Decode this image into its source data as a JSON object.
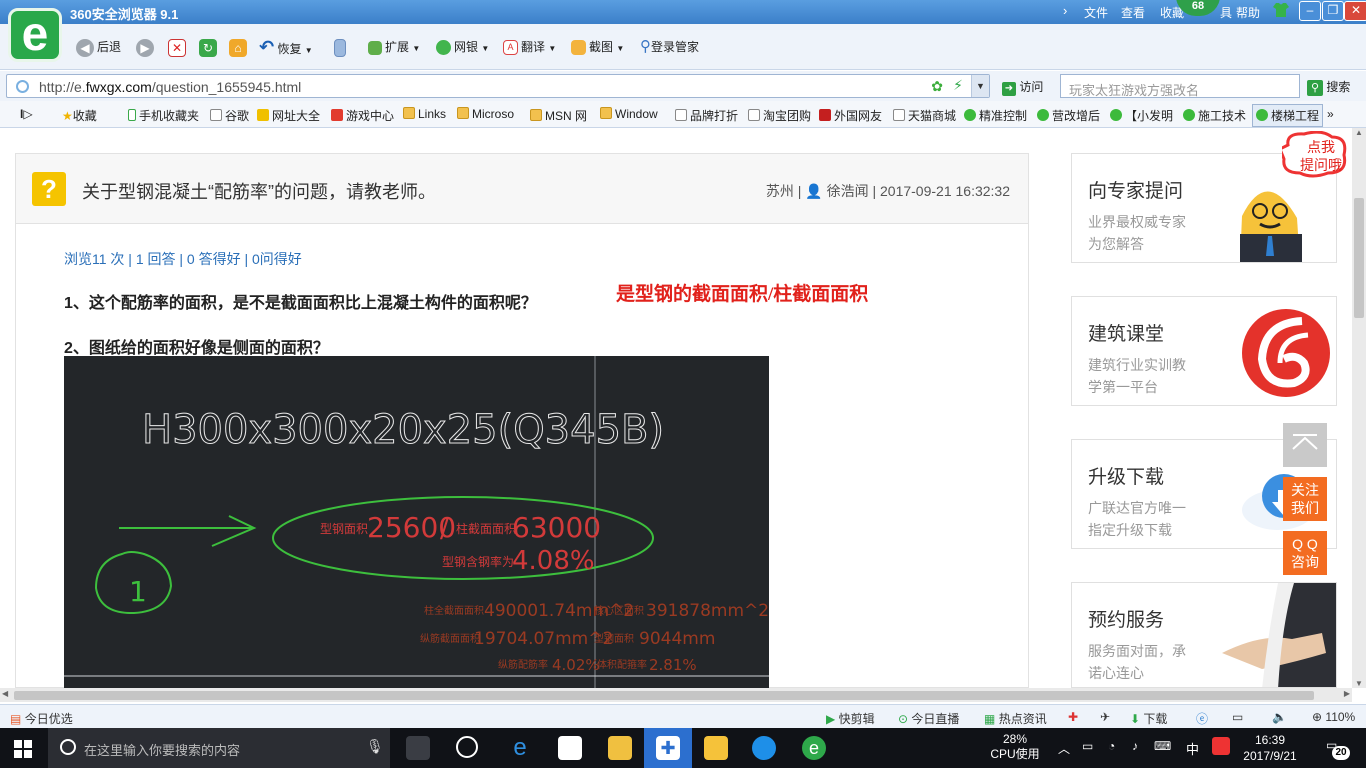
{
  "titlebar": {
    "title": "360安全浏览器 9.1",
    "menu": [
      "文件",
      "查看",
      "收藏",
      "帮助"
    ],
    "badge": "68",
    "badge_suffix": "具"
  },
  "toolbar": {
    "back": "后退",
    "restore": "恢复",
    "extend": "扩展",
    "bank": "网银",
    "translate": "翻译",
    "screenshot": "截图",
    "login": "登录管家"
  },
  "address": {
    "url_prefix": "http://e.",
    "url_domain": "fwxgx.com",
    "url_path": "/question_1655945.html",
    "visit": "访问",
    "search_placeholder": "玩家太狂游戏方强改名",
    "search_label": "搜索"
  },
  "favorites": [
    {
      "label": "收藏",
      "icon": "star-icon"
    },
    {
      "label": "手机收藏夹",
      "icon": "phone-icon"
    },
    {
      "label": "谷歌",
      "icon": "page-icon"
    },
    {
      "label": "网址大全",
      "icon": "globe-icon"
    },
    {
      "label": "游戏中心",
      "icon": "game-icon"
    },
    {
      "label": "Links",
      "icon": "folder-icon"
    },
    {
      "label": "Microso",
      "icon": "folder-icon"
    },
    {
      "label": "MSN 网",
      "icon": "folder-icon"
    },
    {
      "label": "Window",
      "icon": "folder-icon"
    },
    {
      "label": "品牌打折",
      "icon": "page-icon"
    },
    {
      "label": "淘宝团购",
      "icon": "page-icon"
    },
    {
      "label": "外国网友",
      "icon": "page-icon"
    },
    {
      "label": "天猫商城",
      "icon": "page-icon"
    },
    {
      "label": "精准控制",
      "icon": "wechat-icon"
    },
    {
      "label": "营改增后",
      "icon": "wechat-icon"
    },
    {
      "label": "【小发明",
      "icon": "wechat-icon"
    },
    {
      "label": "施工技术",
      "icon": "wechat-icon"
    },
    {
      "label": "楼梯工程",
      "icon": "wechat-icon"
    }
  ],
  "question": {
    "title": "关于型钢混凝土“配筋率”的问题，请教老师。",
    "location": "苏州",
    "author": "徐浩闻",
    "datetime": "2017-09-21 16:32:32",
    "stats": "浏览11 次 | 1 回答 | 0 答得好 | 0问得好",
    "line1": "1、这个配筋率的面积，是不是截面面积比上混凝土构件的面积呢？",
    "answer_note": "是型钢的截面面积/柱截面面积",
    "line2": "2、图纸给的面积好像是侧面的面积？"
  },
  "cad": {
    "heading": "H300x300x20x25(Q345B)",
    "note1_label": "型钢面积",
    "note1_value": "25600",
    "note1_sep": "/",
    "note1_label2": "柱截面面积",
    "note1_value2": "63000",
    "note2_label": "型钢含钢率为",
    "note2_value": "4.08%",
    "row1_label": "柱全截面面积",
    "row1_value": "490001.74mm^2",
    "row1_label2": "核心区面积",
    "row1_value2": "391878mm^2",
    "row2_label": "纵筋截面面积",
    "row2_value": "19704.07mm^2",
    "row2_label2": "型钢面积",
    "row2_value2": "9044mm",
    "row3_label": "纵筋配筋率",
    "row3_value": "4.02%",
    "row3_label2": "体积配箍率",
    "row3_value2": "2.81%",
    "marker": "1"
  },
  "sidebar": {
    "bubble": [
      "点我",
      "提问哦"
    ],
    "cards": [
      {
        "title": "向专家提问",
        "sub1": "业界最权威专家",
        "sub2": "为您解答"
      },
      {
        "title": "建筑课堂",
        "sub1": "建筑行业实训教",
        "sub2": "学第一平台"
      },
      {
        "title": "升级下载",
        "sub1": "广联达官方唯一",
        "sub2": "指定升级下载"
      },
      {
        "title": "预约服务",
        "sub1": "服务面对面，承",
        "sub2": "诺心连心"
      }
    ],
    "float_follow": [
      "关注",
      "我们"
    ],
    "float_qq": [
      "Q Q",
      "咨询"
    ]
  },
  "statusbar": {
    "left": "今日优选",
    "quickcut": "快剪辑",
    "live": "今日直播",
    "hotnews": "热点资讯",
    "download": "下载",
    "zoom": "110%"
  },
  "taskbar": {
    "search_placeholder": "在这里输入你要搜索的内容",
    "cpu_percent": "28%",
    "cpu_label": "CPU使用",
    "ime": "中",
    "time": "16:39",
    "date": "2017/9/21",
    "notifications": "20"
  },
  "colors": {
    "accent_blue": "#3b7fc9",
    "answer_red": "#e1211b",
    "float_orange": "#f36c21",
    "cad_bg": "#232629",
    "cad_green": "#3dbf3d"
  }
}
